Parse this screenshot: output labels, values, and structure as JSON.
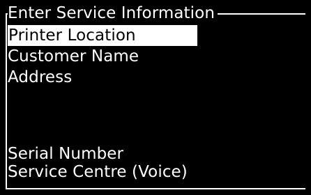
{
  "dialog": {
    "title": "Enter Service Information"
  },
  "menu": {
    "items": [
      {
        "label": "Printer Location",
        "selected": true
      },
      {
        "label": "Customer Name"
      },
      {
        "label": "Address"
      },
      {
        "label": ""
      },
      {
        "label": ""
      },
      {
        "label": ""
      },
      {
        "label": "Serial Number"
      },
      {
        "label": "Service Centre (Voice)"
      }
    ]
  }
}
